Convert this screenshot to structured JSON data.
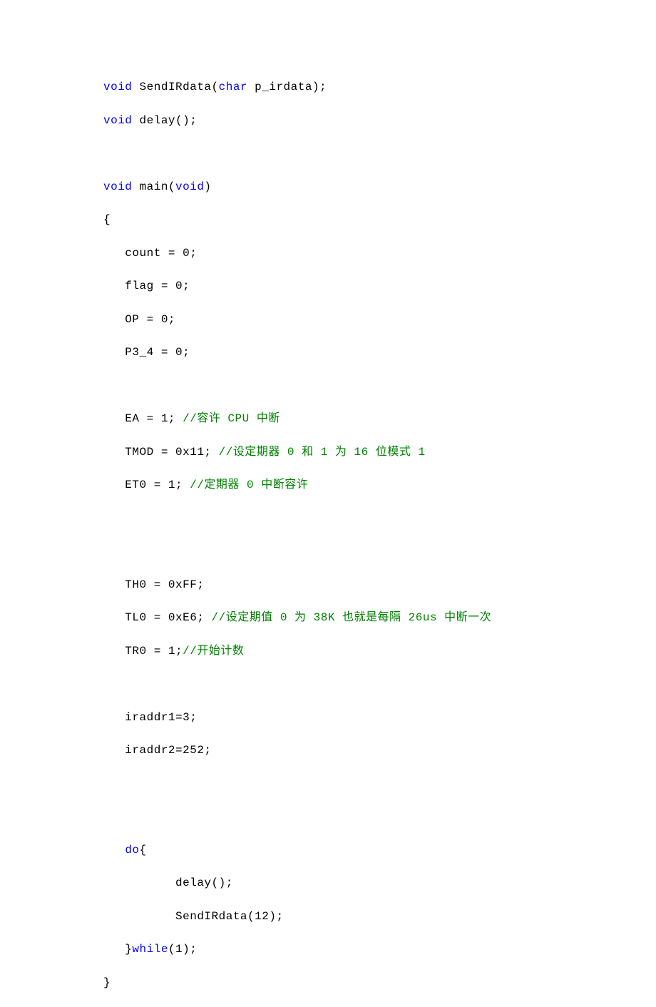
{
  "lines": [
    {
      "segments": [
        {
          "t": "kw",
          "v": "void"
        },
        {
          "t": "n",
          "v": " SendIRdata("
        },
        {
          "t": "kw",
          "v": "char"
        },
        {
          "t": "n",
          "v": " p_irdata);"
        }
      ]
    },
    {
      "segments": [
        {
          "t": "kw",
          "v": "void"
        },
        {
          "t": "n",
          "v": " delay();"
        }
      ]
    },
    {
      "segments": []
    },
    {
      "segments": [
        {
          "t": "kw",
          "v": "void"
        },
        {
          "t": "n",
          "v": " main("
        },
        {
          "t": "kw",
          "v": "void"
        },
        {
          "t": "n",
          "v": ")"
        }
      ]
    },
    {
      "segments": [
        {
          "t": "n",
          "v": "{"
        }
      ]
    },
    {
      "segments": [
        {
          "t": "n",
          "v": "   count = 0;"
        }
      ]
    },
    {
      "segments": [
        {
          "t": "n",
          "v": "   flag = 0;"
        }
      ]
    },
    {
      "segments": [
        {
          "t": "n",
          "v": "   OP = 0;"
        }
      ]
    },
    {
      "segments": [
        {
          "t": "n",
          "v": "   P3_4 = 0;"
        }
      ]
    },
    {
      "segments": []
    },
    {
      "segments": [
        {
          "t": "n",
          "v": "   EA = 1; "
        },
        {
          "t": "cm",
          "v": "//容许 CPU 中断"
        }
      ]
    },
    {
      "segments": [
        {
          "t": "n",
          "v": "   TMOD = 0x11; "
        },
        {
          "t": "cm",
          "v": "//设定期器 0 和 1 为 16 位模式 1"
        }
      ]
    },
    {
      "segments": [
        {
          "t": "n",
          "v": "   ET0 = 1; "
        },
        {
          "t": "cm",
          "v": "//定期器 0 中断容许"
        }
      ]
    },
    {
      "segments": []
    },
    {
      "segments": []
    },
    {
      "segments": [
        {
          "t": "n",
          "v": "   TH0 = 0xFF;"
        }
      ]
    },
    {
      "segments": [
        {
          "t": "n",
          "v": "   TL0 = 0xE6; "
        },
        {
          "t": "cm",
          "v": "//设定期值 0 为 38K 也就是每隔 26us 中断一次"
        }
      ]
    },
    {
      "segments": [
        {
          "t": "n",
          "v": "   TR0 = 1;"
        },
        {
          "t": "cm",
          "v": "//开始计数"
        }
      ]
    },
    {
      "segments": []
    },
    {
      "segments": [
        {
          "t": "n",
          "v": "   iraddr1=3;"
        }
      ]
    },
    {
      "segments": [
        {
          "t": "n",
          "v": "   iraddr2=252;"
        }
      ]
    },
    {
      "segments": []
    },
    {
      "segments": []
    },
    {
      "segments": [
        {
          "t": "n",
          "v": "   "
        },
        {
          "t": "kw",
          "v": "do"
        },
        {
          "t": "n",
          "v": "{"
        }
      ]
    },
    {
      "segments": [
        {
          "t": "n",
          "v": "          delay();"
        }
      ]
    },
    {
      "segments": [
        {
          "t": "n",
          "v": "          SendIRdata(12);"
        }
      ]
    },
    {
      "segments": [
        {
          "t": "n",
          "v": "   }"
        },
        {
          "t": "kw",
          "v": "while"
        },
        {
          "t": "n",
          "v": "(1);"
        }
      ]
    },
    {
      "segments": [
        {
          "t": "n",
          "v": "}"
        }
      ]
    }
  ]
}
